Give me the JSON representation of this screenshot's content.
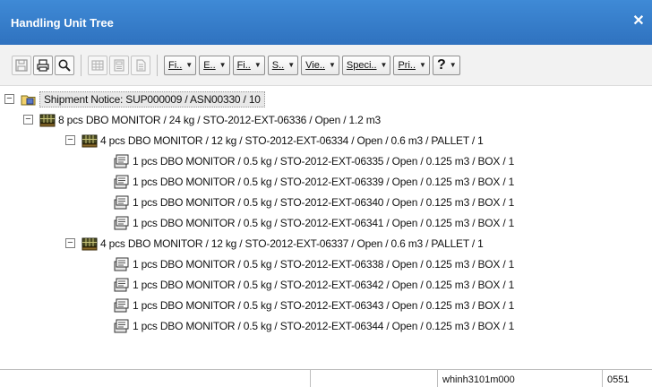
{
  "window": {
    "title": "Handling Unit Tree"
  },
  "toolbar": {
    "dropdowns": [
      {
        "label": "Fi.."
      },
      {
        "label": "E.."
      },
      {
        "label": "Fi.."
      },
      {
        "label": "S.."
      },
      {
        "label": "Vie.."
      },
      {
        "label": "Speci.."
      },
      {
        "label": "Pri.."
      },
      {
        "label": "?"
      }
    ]
  },
  "tree": {
    "root": {
      "label": "Shipment Notice: SUP000009  / ASN00330 / 10"
    },
    "level1": {
      "label": "8 pcs DBO MONITOR / 24 kg / STO-2012-EXT-06336 / Open / 1.2 m3"
    },
    "pallet1": {
      "label": "4 pcs DBO MONITOR / 12 kg / STO-2012-EXT-06334 / Open / 0.6 m3 / PALLET / 1",
      "boxes": [
        "1 pcs DBO MONITOR / 0.5 kg / STO-2012-EXT-06335 / Open / 0.125 m3 / BOX / 1",
        "1 pcs DBO MONITOR / 0.5 kg / STO-2012-EXT-06339 / Open / 0.125 m3 / BOX / 1",
        "1 pcs DBO MONITOR / 0.5 kg / STO-2012-EXT-06340 / Open / 0.125 m3 / BOX / 1",
        "1 pcs DBO MONITOR / 0.5 kg / STO-2012-EXT-06341 / Open / 0.125 m3 / BOX / 1"
      ]
    },
    "pallet2": {
      "label": "4 pcs DBO MONITOR / 12 kg / STO-2012-EXT-06337 / Open / 0.6 m3 / PALLET / 1",
      "boxes": [
        "1 pcs DBO MONITOR / 0.5 kg / STO-2012-EXT-06338 / Open / 0.125 m3 / BOX / 1",
        "1 pcs DBO MONITOR / 0.5 kg / STO-2012-EXT-06342 / Open / 0.125 m3 / BOX / 1",
        "1 pcs DBO MONITOR / 0.5 kg / STO-2012-EXT-06343 / Open / 0.125 m3 / BOX / 1",
        "1 pcs DBO MONITOR / 0.5 kg / STO-2012-EXT-06344 / Open / 0.125 m3 / BOX / 1"
      ]
    }
  },
  "status": {
    "session": "whinh3101m000",
    "company": "0551"
  },
  "colors": {
    "titlebar": "#2f72bf",
    "selection": "#e8e8e8",
    "pallet_icon": "#3b3b1a"
  }
}
